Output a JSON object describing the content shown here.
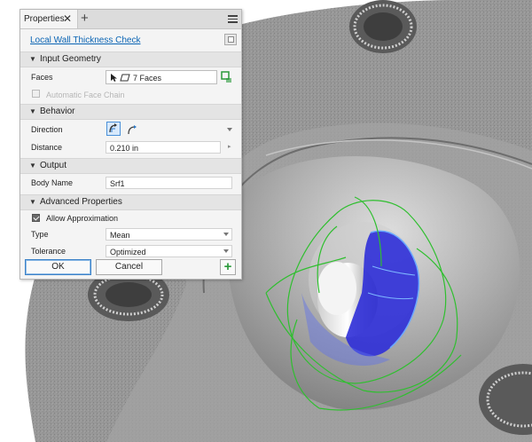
{
  "panel": {
    "tab_label": "Properties",
    "close_glyph": "✕",
    "add_glyph": "+",
    "command_title": "Local Wall Thickness Check",
    "sections": {
      "input_geometry": "Input Geometry",
      "behavior": "Behavior",
      "output": "Output",
      "advanced": "Advanced Properties"
    },
    "faces": {
      "label": "Faces",
      "value": "7 Faces"
    },
    "auto_face_chain": {
      "label": "Automatic Face Chain",
      "checked": false,
      "enabled": false
    },
    "direction": {
      "label": "Direction"
    },
    "distance": {
      "label": "Distance",
      "value": "0.210 in"
    },
    "body_name": {
      "label": "Body Name",
      "value": "Srf1"
    },
    "allow_approximation": {
      "label": "Allow Approximation",
      "checked": true
    },
    "type": {
      "label": "Type",
      "value": "Mean"
    },
    "tolerance": {
      "label": "Tolerance",
      "value": "Optimized"
    },
    "buttons": {
      "ok": "OK",
      "cancel": "Cancel",
      "add": "+"
    }
  },
  "icons": {
    "menu": "hamburger-menu-icon",
    "cursor": "select-cursor-icon",
    "face": "face-select-icon",
    "chain": "face-chain-icon",
    "dir1": "direction-inward-icon",
    "dir2": "direction-outward-icon",
    "add": "plus-icon"
  },
  "colors": {
    "link": "#0a64b4",
    "highlight_body": "#3a3ae0",
    "preview_wire": "#2fbf2f",
    "add_button": "#2a9a3a"
  }
}
